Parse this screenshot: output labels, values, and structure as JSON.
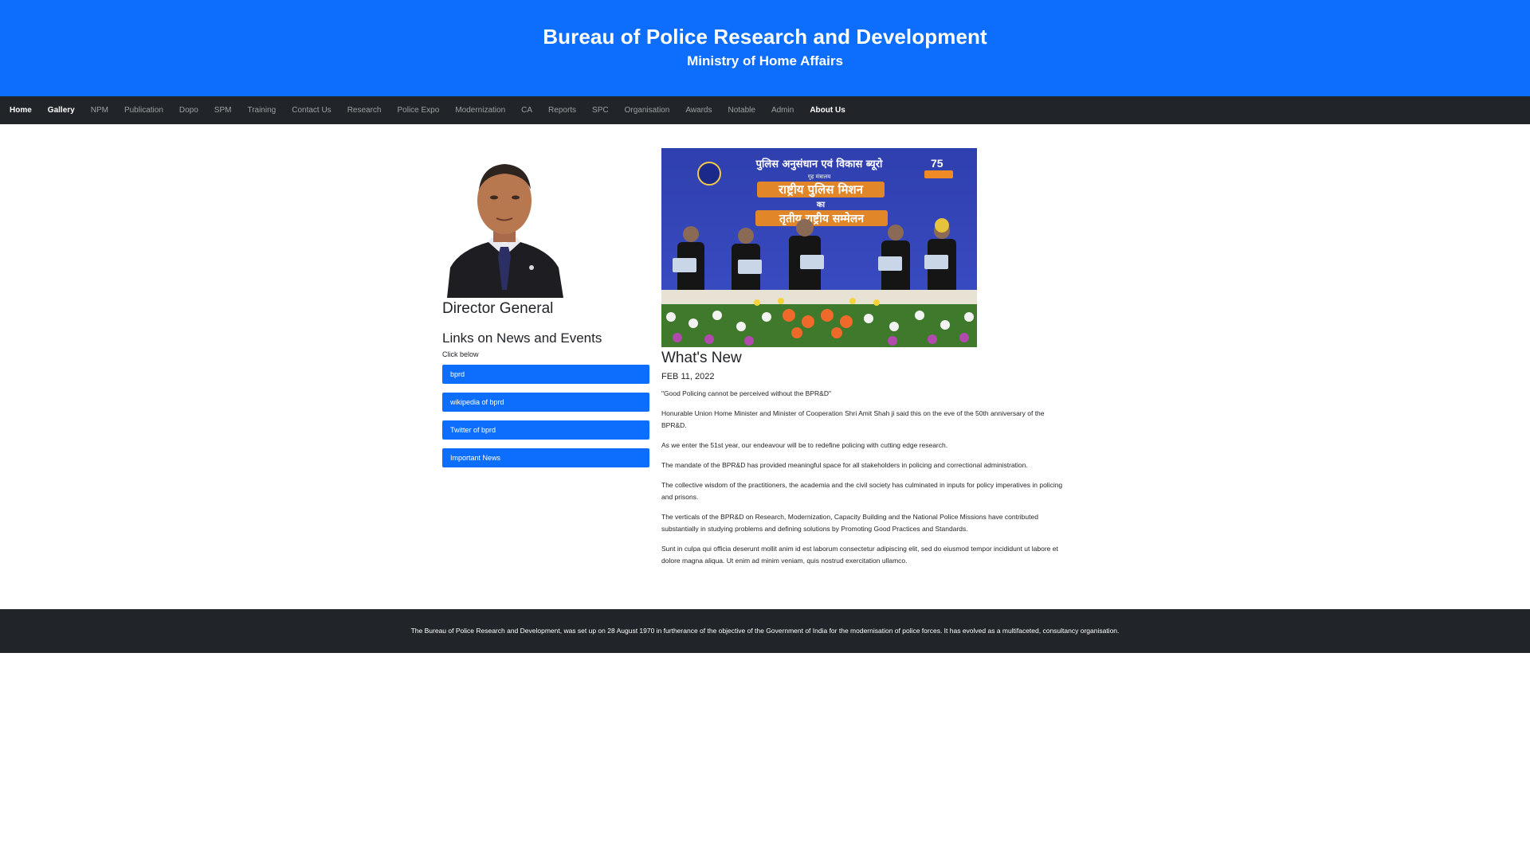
{
  "header": {
    "title": "Bureau of Police Research and Development",
    "subtitle": "Ministry of Home Affairs"
  },
  "nav": {
    "items": [
      {
        "label": "Home",
        "active": true
      },
      {
        "label": "Gallery",
        "active": true
      },
      {
        "label": "NPM",
        "active": false
      },
      {
        "label": "Publication",
        "active": false
      },
      {
        "label": "Dopo",
        "active": false
      },
      {
        "label": "SPM",
        "active": false
      },
      {
        "label": "Training",
        "active": false
      },
      {
        "label": "Contact Us",
        "active": false
      },
      {
        "label": "Research",
        "active": false
      },
      {
        "label": "Police Expo",
        "active": false
      },
      {
        "label": "Modernization",
        "active": false
      },
      {
        "label": "CA",
        "active": false
      },
      {
        "label": "Reports",
        "active": false
      },
      {
        "label": "SPC",
        "active": false
      },
      {
        "label": "Organisation",
        "active": false
      },
      {
        "label": "Awards",
        "active": false
      },
      {
        "label": "Notable",
        "active": false
      },
      {
        "label": "Admin",
        "active": false
      },
      {
        "label": "About Us",
        "active": true
      }
    ]
  },
  "sidebar": {
    "dg_title": "Director General",
    "links_heading": "Links on News and Events",
    "click_below": "Click below",
    "links": [
      {
        "label": "bprd"
      },
      {
        "label": "wikipedia of bprd"
      },
      {
        "label": "Twitter of bprd"
      },
      {
        "label": "Important News"
      }
    ]
  },
  "event_banner": {
    "banner_line1": "पुलिस अनुसंधान एवं विकास ब्यूरो",
    "banner_line2": "गृह मंत्रालय",
    "banner_line3": "राष्ट्रीय पुलिस मिशन",
    "banner_line4": "का",
    "banner_line5": "तृतीय राष्ट्रीय सम्मेलन"
  },
  "news": {
    "heading": "What's New",
    "date": "FEB 11, 2022",
    "paragraphs": [
      "\"Good Policing cannot be perceived without the BPR&D\"",
      "Honurable Union Home Minister and Minister of Cooperation Shri Amit Shah ji said this on the eve of the 50th anniversary of the BPR&D.",
      "As we enter the 51st year, our endeavour will be to redefine policing with cutting edge research.",
      "The mandate of the BPR&D has provided meaningful space for all stakeholders in policing and correctional administration.",
      "The collective wisdom of the practitioners, the academia and the civil society has culminated in inputs for policy imperatives in policing and prisons.",
      "The verticals of the BPR&D on Research, Modernization, Capacity Building and the National Police Missions have contributed substantially in studying problems and defining solutions by Promoting Good Practices and Standards.",
      "Sunt in culpa qui officia deserunt mollit anim id est laborum consectetur adipiscing elit, sed do eiusmod tempor incididunt ut labore et dolore magna aliqua. Ut enim ad minim veniam, quis nostrud exercitation ullamco."
    ]
  },
  "footer": {
    "text": "The Bureau of Police Research and Development, was set up on 28 August 1970 in furtherance of the objective of the Government of India for the modernisation of police forces. It has evolved as a multifaceted, consultancy organisation."
  },
  "colors": {
    "primary": "#0d6efd",
    "dark": "#212529"
  }
}
